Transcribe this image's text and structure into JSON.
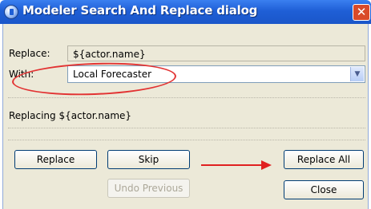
{
  "window": {
    "title": "Modeler Search And Replace dialog",
    "close_glyph": "✕"
  },
  "form": {
    "replace_label": "Replace:",
    "replace_value": "${actor.name}",
    "with_label": "With:",
    "with_value": "Local Forecaster",
    "status": "Replacing ${actor.name}"
  },
  "buttons": {
    "replace": "Replace",
    "skip": "Skip",
    "replace_all": "Replace All",
    "undo_previous": "Undo Previous",
    "close": "Close"
  },
  "annotations": {
    "highlight_color": "#e02020"
  },
  "colors": {
    "titlebar": "#1f5fd6",
    "dialog_bg": "#ece9d8"
  }
}
